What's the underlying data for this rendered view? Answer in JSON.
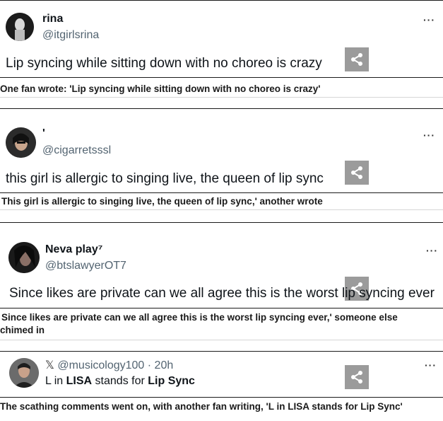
{
  "posts": [
    {
      "name": "rina",
      "handle": "@itgirlsrina",
      "text": "Lip syncing while sitting down with no choreo is crazy",
      "caption": "One fan wrote: 'Lip syncing while sitting down with no choreo is crazy'",
      "more_icon": "more-dots-icon",
      "share_icon": "share-icon"
    },
    {
      "name": "'",
      "handle": "@cigarretsssl",
      "text": "this girl is allergic to singing live, the queen of lip sync",
      "caption": "This girl is allergic to singing live, the queen of lip sync,' another wrote",
      "more_icon": "more-dots-icon",
      "share_icon": "share-icon"
    },
    {
      "name": "Neva play⁷",
      "handle": "@btslawyerOT7",
      "text": "Since likes are private can we all agree this is the worst lip syncing ever",
      "caption_line1": "Since likes are private can we all agree this is the worst lip syncing ever,' someone else",
      "caption_line2": "chimed in",
      "more_icon": "more-dots-icon",
      "share_icon": "share-icon"
    },
    {
      "platform_glyph": "𝕏",
      "handle": "@musicology100",
      "separator": "·",
      "time": "20h",
      "text_pre": "L in ",
      "text_bold1": "LISA",
      "text_mid": " stands for ",
      "text_bold2": "Lip Sync",
      "caption": "The scathing comments went on, with another fan writing, 'L in LISA stands for Lip Sync'",
      "more_icon": "more-dots-icon",
      "share_icon": "share-icon"
    }
  ],
  "more_glyph": "···"
}
